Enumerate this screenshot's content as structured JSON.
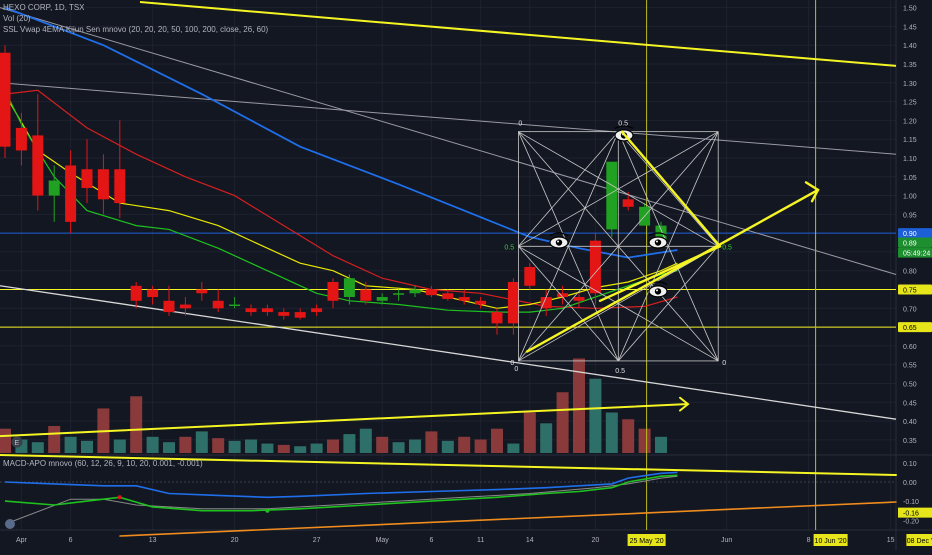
{
  "header": {
    "title_line": "HEXO CORP, 1D, TSX",
    "volume_line": "Vol (20)",
    "indicator_line": "SSL Vwap 4EMA Kijun Sen mnovo (20, 20, 20, 50, 100, 200, close, 26, 60)"
  },
  "macd_label": "MACD-APO mnovo (60, 12, 26, 9, 10, 20, 0.001, -0.001)",
  "colors": {
    "background": "#131722",
    "up_candle": "#089981",
    "up_candle_bright": "#21a121",
    "down_candle": "#e31515",
    "vol_up": "#2f6f6a",
    "vol_down": "#8a3a3a",
    "ma_blue": "#1f6feb",
    "ma_red": "#d61f1f",
    "ma_yellow": "#e8e800",
    "ma_green": "#1ec21e",
    "trendline_white": "#d8d8d8",
    "annotation_yellow": "#f5f523",
    "macd_orange": "#f08c1e",
    "badge_blue": "#1d5fd6",
    "badge_green": "#1e8f2e",
    "badge_yellow": "#e6e61a"
  },
  "price_axis": {
    "ticks": [
      "1.50",
      "1.45",
      "1.40",
      "1.35",
      "1.30",
      "1.25",
      "1.20",
      "1.15",
      "1.10",
      "1.05",
      "1.00",
      "0.95",
      "0.90",
      "0.85",
      "0.80",
      "0.75",
      "0.70",
      "0.65",
      "0.60",
      "0.55",
      "0.50",
      "0.45",
      "0.40",
      "0.35"
    ],
    "range": [
      0.315,
      1.515
    ],
    "badges": [
      {
        "label": "0.90",
        "value": 0.9,
        "color": "blue"
      },
      {
        "label": "0.89",
        "value": 0.875,
        "color": "green"
      },
      {
        "label": "05:49:24",
        "value": 0.848,
        "color": "green"
      },
      {
        "label": "0.75",
        "value": 0.75,
        "color": "yellow"
      },
      {
        "label": "0.65",
        "value": 0.65,
        "color": "yellow"
      }
    ]
  },
  "macd_axis": {
    "ticks": [
      "0.10",
      "0.00",
      "-0.10",
      "-0.20"
    ],
    "range": [
      -0.235,
      0.125
    ],
    "badge": {
      "label": "-0.16",
      "value": -0.16
    }
  },
  "time_axis": {
    "ticks": [
      {
        "label": "Apr",
        "i": 1
      },
      {
        "label": "6",
        "i": 4
      },
      {
        "label": "13",
        "i": 9
      },
      {
        "label": "20",
        "i": 14
      },
      {
        "label": "27",
        "i": 19
      },
      {
        "label": "May",
        "i": 23
      },
      {
        "label": "6",
        "i": 26
      },
      {
        "label": "11",
        "i": 29
      },
      {
        "label": "14",
        "i": 32
      },
      {
        "label": "20",
        "i": 36
      },
      {
        "label": "Jun",
        "i": 44
      },
      {
        "label": "8",
        "i": 49
      },
      {
        "label": "15",
        "i": 54
      }
    ],
    "highlights": [
      {
        "label": "25 May '20",
        "i": 39
      },
      {
        "label": "10 Jun '20",
        "i": 51
      },
      {
        "label": "08 Dec '21",
        "i": 56
      }
    ]
  },
  "chart_data": {
    "type": "candlestick",
    "ylim": [
      0.315,
      1.515
    ],
    "ohlc": [
      [
        1.38,
        1.4,
        1.1,
        1.13
      ],
      [
        1.18,
        1.22,
        1.08,
        1.12
      ],
      [
        1.16,
        1.27,
        0.96,
        1.0
      ],
      [
        1.0,
        1.08,
        0.93,
        1.04
      ],
      [
        1.08,
        1.12,
        0.9,
        0.93
      ],
      [
        1.07,
        1.15,
        0.98,
        1.02
      ],
      [
        1.07,
        1.11,
        0.95,
        0.99
      ],
      [
        1.07,
        1.2,
        0.94,
        0.98
      ],
      [
        0.76,
        0.77,
        0.7,
        0.72
      ],
      [
        0.75,
        0.76,
        0.71,
        0.73
      ],
      [
        0.72,
        0.76,
        0.68,
        0.69
      ],
      [
        0.71,
        0.73,
        0.68,
        0.7
      ],
      [
        0.75,
        0.77,
        0.72,
        0.74
      ],
      [
        0.72,
        0.75,
        0.69,
        0.7
      ],
      [
        0.71,
        0.73,
        0.7,
        0.71
      ],
      [
        0.7,
        0.71,
        0.68,
        0.69
      ],
      [
        0.7,
        0.71,
        0.68,
        0.69
      ],
      [
        0.69,
        0.7,
        0.67,
        0.68
      ],
      [
        0.69,
        0.7,
        0.67,
        0.675
      ],
      [
        0.7,
        0.71,
        0.68,
        0.69
      ],
      [
        0.77,
        0.78,
        0.7,
        0.72
      ],
      [
        0.73,
        0.79,
        0.71,
        0.78
      ],
      [
        0.75,
        0.77,
        0.71,
        0.72
      ],
      [
        0.72,
        0.74,
        0.71,
        0.73
      ],
      [
        0.74,
        0.75,
        0.72,
        0.74
      ],
      [
        0.74,
        0.76,
        0.73,
        0.75
      ],
      [
        0.75,
        0.76,
        0.73,
        0.735
      ],
      [
        0.74,
        0.75,
        0.72,
        0.725
      ],
      [
        0.73,
        0.75,
        0.71,
        0.72
      ],
      [
        0.72,
        0.73,
        0.7,
        0.71
      ],
      [
        0.69,
        0.7,
        0.63,
        0.66
      ],
      [
        0.77,
        0.78,
        0.63,
        0.66
      ],
      [
        0.81,
        0.82,
        0.75,
        0.76
      ],
      [
        0.73,
        0.75,
        0.68,
        0.7
      ],
      [
        0.74,
        0.76,
        0.71,
        0.73
      ],
      [
        0.73,
        0.74,
        0.7,
        0.72
      ],
      [
        0.88,
        0.9,
        0.71,
        0.74
      ],
      [
        0.91,
        1.04,
        0.89,
        1.09
      ],
      [
        0.99,
        1.01,
        0.96,
        0.97
      ],
      [
        0.92,
        0.98,
        0.92,
        0.97
      ],
      [
        0.88,
        0.93,
        0.87,
        0.92
      ]
    ],
    "volume": [
      0.18,
      0.1,
      0.08,
      0.2,
      0.12,
      0.09,
      0.33,
      0.1,
      0.42,
      0.12,
      0.08,
      0.12,
      0.16,
      0.11,
      0.09,
      0.1,
      0.07,
      0.06,
      0.05,
      0.07,
      0.1,
      0.14,
      0.18,
      0.12,
      0.08,
      0.1,
      0.16,
      0.09,
      0.12,
      0.1,
      0.18,
      0.07,
      0.3,
      0.22,
      0.45,
      0.7,
      0.55,
      0.3,
      0.25,
      0.18,
      0.12
    ],
    "volume_up": [
      false,
      true,
      true,
      false,
      true,
      true,
      false,
      true,
      false,
      true,
      true,
      false,
      true,
      false,
      true,
      true,
      true,
      false,
      true,
      true,
      false,
      true,
      true,
      false,
      true,
      true,
      false,
      true,
      false,
      false,
      false,
      true,
      false,
      true,
      false,
      false,
      true,
      true,
      false,
      false,
      true
    ],
    "ma_blue": [
      [
        0,
        1.5
      ],
      [
        6,
        1.4
      ],
      [
        12,
        1.27
      ],
      [
        18,
        1.13
      ],
      [
        24,
        1.03
      ],
      [
        28,
        0.96
      ],
      [
        32,
        0.89
      ],
      [
        35,
        0.86
      ],
      [
        38,
        0.835
      ],
      [
        41,
        0.855
      ]
    ],
    "ma_red": [
      [
        0,
        1.27
      ],
      [
        2,
        1.28
      ],
      [
        5,
        1.18
      ],
      [
        8,
        1.11
      ],
      [
        11,
        1.05
      ],
      [
        14,
        1.0
      ],
      [
        17,
        0.92
      ],
      [
        20,
        0.84
      ],
      [
        23,
        0.78
      ],
      [
        26,
        0.75
      ],
      [
        29,
        0.74
      ],
      [
        33,
        0.705
      ],
      [
        36,
        0.7
      ],
      [
        39,
        0.705
      ],
      [
        41,
        0.73
      ]
    ],
    "ma_yellow": [
      [
        0,
        1.27
      ],
      [
        2,
        1.12
      ],
      [
        4,
        1.06
      ],
      [
        7,
        0.98
      ],
      [
        10,
        0.96
      ],
      [
        13,
        0.92
      ],
      [
        16,
        0.86
      ],
      [
        18,
        0.82
      ],
      [
        20,
        0.8
      ],
      [
        22,
        0.76
      ],
      [
        25,
        0.75
      ],
      [
        28,
        0.72
      ],
      [
        30,
        0.7
      ],
      [
        32,
        0.71
      ],
      [
        34,
        0.73
      ],
      [
        36,
        0.755
      ],
      [
        38,
        0.77
      ],
      [
        40,
        0.8
      ],
      [
        41,
        0.82
      ]
    ],
    "ma_green": [
      [
        0,
        1.28
      ],
      [
        1,
        1.19
      ],
      [
        3,
        1.05
      ],
      [
        5,
        0.96
      ],
      [
        8,
        0.92
      ],
      [
        10,
        0.91
      ],
      [
        13,
        0.86
      ],
      [
        15,
        0.82
      ],
      [
        17,
        0.78
      ],
      [
        19,
        0.74
      ],
      [
        21,
        0.72
      ],
      [
        24,
        0.71
      ],
      [
        27,
        0.695
      ],
      [
        30,
        0.69
      ],
      [
        32,
        0.69
      ],
      [
        34,
        0.7
      ],
      [
        36,
        0.73
      ],
      [
        38,
        0.76
      ],
      [
        40,
        0.79
      ],
      [
        41,
        0.8
      ]
    ],
    "macd_blue": [
      [
        0,
        0.0
      ],
      [
        3,
        -0.01
      ],
      [
        6,
        -0.02
      ],
      [
        8,
        -0.02
      ],
      [
        10,
        -0.06
      ],
      [
        13,
        -0.07
      ],
      [
        16,
        -0.08
      ],
      [
        18,
        -0.075
      ],
      [
        22,
        -0.06
      ],
      [
        26,
        -0.05
      ],
      [
        30,
        -0.04
      ],
      [
        33,
        -0.03
      ],
      [
        35,
        -0.02
      ],
      [
        37,
        -0.01
      ],
      [
        38,
        0.02
      ],
      [
        40,
        0.045
      ],
      [
        41,
        0.05
      ]
    ],
    "macd_green": [
      [
        0,
        -0.1
      ],
      [
        3,
        -0.12
      ],
      [
        5,
        -0.1
      ],
      [
        7,
        -0.08
      ],
      [
        9,
        -0.13
      ],
      [
        12,
        -0.15
      ],
      [
        15,
        -0.15
      ],
      [
        18,
        -0.14
      ],
      [
        22,
        -0.12
      ],
      [
        26,
        -0.1
      ],
      [
        30,
        -0.08
      ],
      [
        33,
        -0.06
      ],
      [
        35,
        -0.05
      ],
      [
        37,
        -0.03
      ],
      [
        38,
        0.0
      ],
      [
        40,
        0.03
      ],
      [
        41,
        0.035
      ]
    ],
    "macd_gray": [
      [
        0,
        -0.22
      ],
      [
        4,
        -0.09
      ],
      [
        6,
        -0.09
      ],
      [
        8,
        -0.12
      ],
      [
        12,
        -0.14
      ],
      [
        16,
        -0.14
      ],
      [
        20,
        -0.12
      ],
      [
        24,
        -0.1
      ],
      [
        28,
        -0.08
      ],
      [
        32,
        -0.06
      ],
      [
        36,
        -0.03
      ],
      [
        38,
        -0.01
      ],
      [
        40,
        0.02
      ],
      [
        41,
        0.03
      ]
    ],
    "gann_box": {
      "i0": 31,
      "i1": 43,
      "top": 1.17,
      "bottom": 0.56,
      "corner_labels": [
        "0",
        "0.5",
        "0",
        "0.5",
        "0.5",
        "0",
        "0.5",
        "0"
      ]
    }
  }
}
